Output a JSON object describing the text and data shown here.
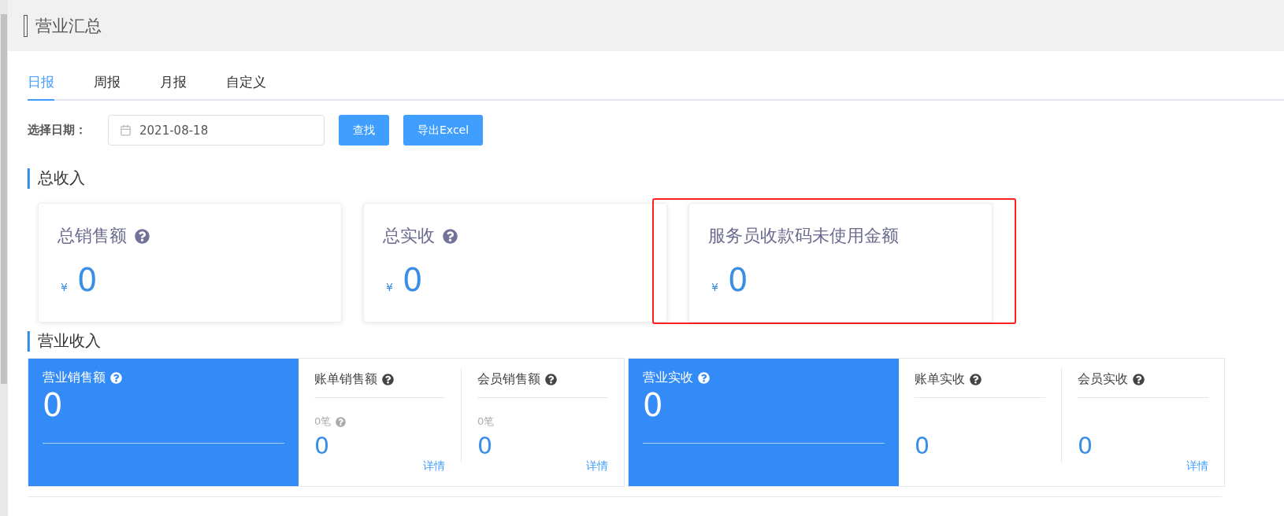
{
  "page": {
    "title": "营业汇总"
  },
  "tabs": [
    {
      "label": "日报",
      "selected": true
    },
    {
      "label": "周报",
      "selected": false
    },
    {
      "label": "月报",
      "selected": false
    },
    {
      "label": "自定义",
      "selected": false
    }
  ],
  "filter": {
    "label": "选择日期：",
    "date": "2021-08-18",
    "buttons": [
      "查找",
      "导出Excel"
    ]
  },
  "total_income": {
    "heading": "总收入",
    "cards": [
      {
        "title": "总销售额",
        "help": true,
        "currency": "¥",
        "value": "0",
        "highlighted": false
      },
      {
        "title": "总实收",
        "help": true,
        "currency": "¥",
        "value": "0",
        "highlighted": false
      },
      {
        "title": "服务员收款码未使用金额",
        "help": false,
        "currency": "¥",
        "value": "0",
        "highlighted": true
      }
    ]
  },
  "business_income": {
    "heading": "营业收入",
    "groups": [
      {
        "main": {
          "title": "营业销售额",
          "value": "0"
        },
        "items": [
          {
            "title": "账单销售额",
            "count": "0笔",
            "count_help": true,
            "value": "0",
            "detail": "详情"
          },
          {
            "title": "会员销售额",
            "count": "0笔",
            "count_help": false,
            "value": "0",
            "detail": "详情"
          }
        ]
      },
      {
        "main": {
          "title": "营业实收",
          "value": "0"
        },
        "items": [
          {
            "title": "账单实收",
            "count_help": false,
            "value": "0"
          },
          {
            "title": "会员实收",
            "count_help": false,
            "value": "0",
            "detail": "详情"
          }
        ]
      }
    ]
  }
}
